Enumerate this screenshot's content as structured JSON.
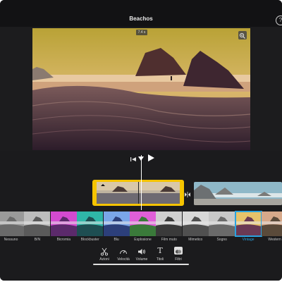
{
  "header": {
    "title": "Beachos",
    "help_label": "?"
  },
  "viewer": {
    "timecode": "7.4 s"
  },
  "filters": [
    {
      "name": "Nessuno",
      "active": false
    },
    {
      "name": "B/N",
      "active": false
    },
    {
      "name": "Bicromia",
      "active": false
    },
    {
      "name": "Blockbuster",
      "active": false
    },
    {
      "name": "Blu",
      "active": false
    },
    {
      "name": "Esplosione",
      "active": false
    },
    {
      "name": "Film muto",
      "active": false
    },
    {
      "name": "Mimetico",
      "active": false
    },
    {
      "name": "Sogno",
      "active": false
    },
    {
      "name": "Vintage",
      "active": true
    },
    {
      "name": "Western",
      "active": false
    }
  ],
  "toolbar": {
    "actions_label": "Azioni",
    "speed_label": "Velocità",
    "volume_label": "Volume",
    "titles_label": "Titoli",
    "filters_label": "Filtri",
    "titles_icon_glyph": "T"
  },
  "colors": {
    "selection_accent": "#f5c400",
    "active_filter": "#2aa3e0"
  }
}
